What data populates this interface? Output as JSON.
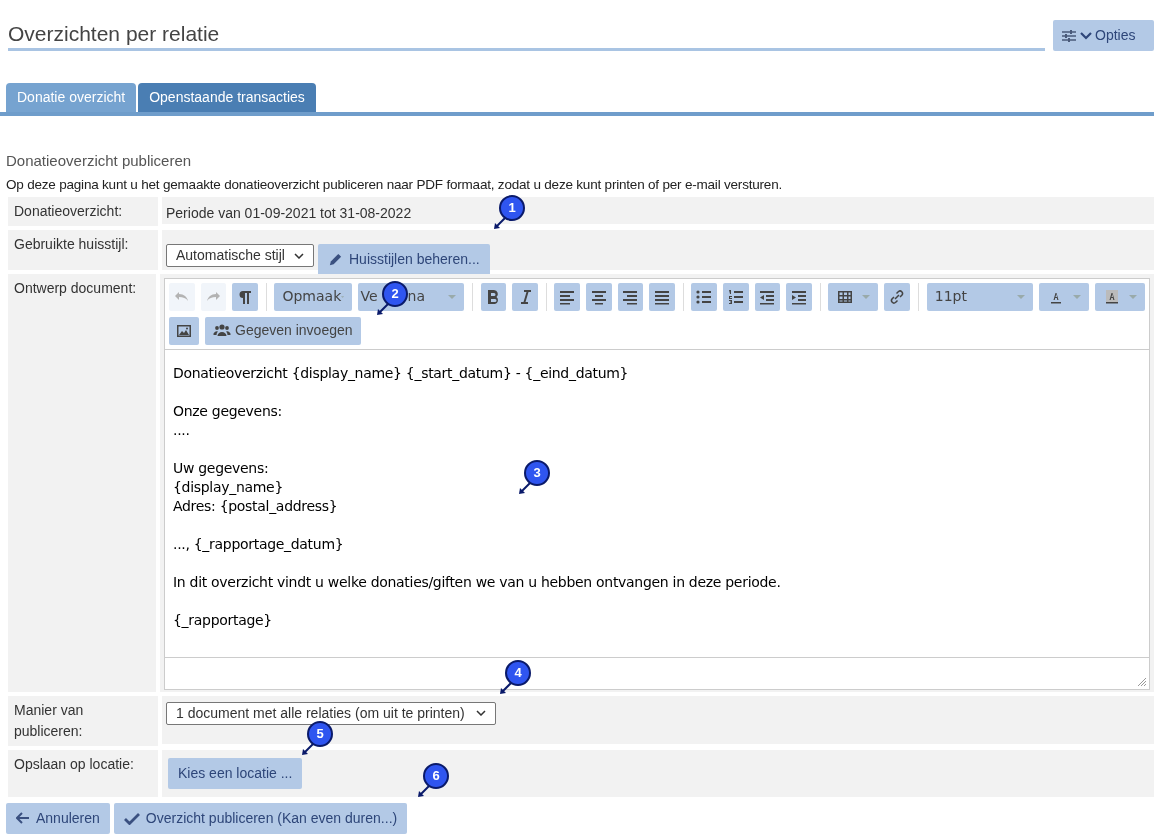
{
  "page_title": "Overzichten per relatie",
  "options_button": "Opties",
  "tabs": [
    {
      "label": "Donatie overzicht",
      "selected": true
    },
    {
      "label": "Openstaande transacties",
      "selected": false
    }
  ],
  "section_title": "Donatieoverzicht publiceren",
  "description": "Op deze pagina kunt u het gemaakte donatieoverzicht publiceren naar PDF formaat, zodat u deze kunt printen of per e-mail versturen.",
  "form": {
    "overview_label": "Donatieoverzicht:",
    "overview_value": "Periode van 01-09-2021 tot 31-08-2022",
    "style_label": "Gebruikte huisstijl:",
    "style_select": "Automatische stijl",
    "manage_styles_button": "Huisstijlen beheren...",
    "design_label": "Ontwerp document:",
    "publish_label": "Manier van publiceren:",
    "publish_select": "1 document met alle relaties (om uit te printen)",
    "location_label": "Opslaan op locatie:",
    "location_button": "Kies een locatie ..."
  },
  "editor": {
    "toolbar": [
      {
        "kind": "icon",
        "disabled": true
      },
      {
        "kind": "icon",
        "disabled": true
      },
      {
        "kind": "icon",
        "disabled": false
      },
      {
        "kind": "dropdown",
        "label": "Opmaak"
      },
      {
        "kind": "dropdown",
        "label_parts": [
          "Ve",
          "na"
        ]
      },
      {
        "kind": "icon",
        "disabled": false
      },
      {
        "kind": "icon",
        "disabled": false
      },
      {
        "kind": "icon",
        "disabled": false
      },
      {
        "kind": "icon",
        "disabled": false
      },
      {
        "kind": "icon",
        "disabled": false
      },
      {
        "kind": "icon",
        "disabled": false
      },
      {
        "kind": "icon",
        "disabled": false
      },
      {
        "kind": "icon",
        "disabled": false
      },
      {
        "kind": "icon",
        "disabled": false
      },
      {
        "kind": "icon",
        "disabled": false
      },
      {
        "kind": "split",
        "disabled": false
      },
      {
        "kind": "icon",
        "disabled": false
      },
      {
        "kind": "dropdown",
        "label": "11pt"
      },
      {
        "kind": "split",
        "disabled": false
      },
      {
        "kind": "split",
        "disabled": false
      },
      {
        "kind": "icon",
        "disabled": false
      },
      {
        "kind": "labeled",
        "label": "Gegeven invoegen"
      }
    ],
    "paragraphs": [
      [
        "Donatieoverzicht {display_name} {_start_datum} - {_eind_datum}"
      ],
      [
        "Onze gegevens:",
        "...."
      ],
      [
        "Uw gegevens:",
        "{display_name}",
        "Adres: {postal_address}"
      ],
      [
        "..., {_rapportage_datum}"
      ],
      [
        "In dit overzicht vindt u welke donaties/giften we van u hebben ontvangen in deze periode."
      ],
      [
        "{_rapportage}"
      ]
    ]
  },
  "buttons": [
    {
      "label": "Annuleren"
    },
    {
      "label": "Overzicht publiceren (Kan even duren...)"
    }
  ],
  "callouts": [
    "1",
    "2",
    "3",
    "4",
    "5",
    "6"
  ]
}
